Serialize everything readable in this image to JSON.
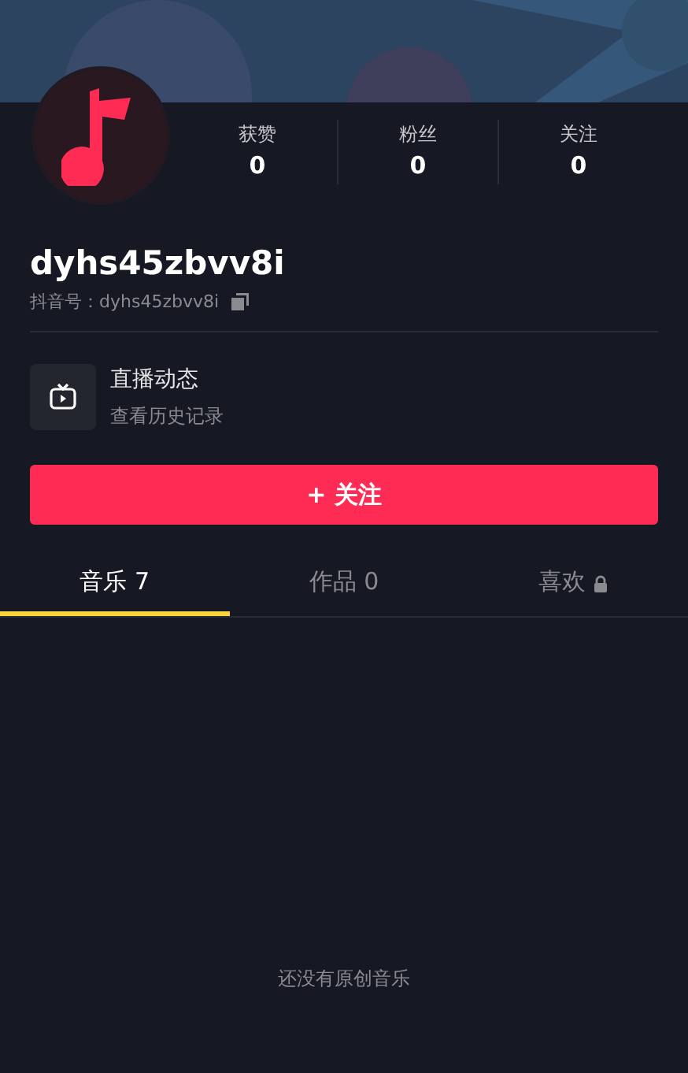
{
  "profile": {
    "username": "dyhs45zbvv8i",
    "id_label": "抖音号：dyhs45zbvv8i"
  },
  "stats": [
    {
      "label": "获赞",
      "value": "0"
    },
    {
      "label": "粉丝",
      "value": "0"
    },
    {
      "label": "关注",
      "value": "0"
    }
  ],
  "live": {
    "title": "直播动态",
    "subtitle": "查看历史记录"
  },
  "follow_button": {
    "icon": "+",
    "label": "关注"
  },
  "tabs": [
    {
      "label": "音乐 7",
      "selected": true,
      "locked": false
    },
    {
      "label": "作品 0",
      "selected": false,
      "locked": false
    },
    {
      "label": "喜欢",
      "selected": false,
      "locked": true
    }
  ],
  "empty_message": "还没有原创音乐"
}
